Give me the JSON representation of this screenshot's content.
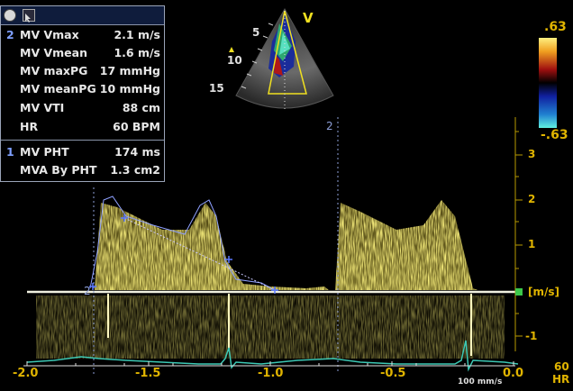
{
  "measurements_panel": {
    "groups": [
      {
        "index": "2",
        "rows": [
          {
            "label": "MV Vmax",
            "value": "2.1 m/s"
          },
          {
            "label": "MV Vmean",
            "value": "1.6 m/s"
          },
          {
            "label": "MV maxPG",
            "value": "17 mmHg"
          },
          {
            "label": "MV meanPG",
            "value": "10 mmHg"
          },
          {
            "label": "MV VTI",
            "value": "88 cm"
          },
          {
            "label": "HR",
            "value": "60 BPM"
          }
        ]
      },
      {
        "index": "1",
        "rows": [
          {
            "label": "MV PHT",
            "value": "174 ms"
          },
          {
            "label": "MVA By PHT",
            "value": "1.3 cm2"
          }
        ]
      }
    ]
  },
  "sector": {
    "orientation_marker": "V",
    "depth_labels": [
      "5",
      "10",
      "15"
    ]
  },
  "color_scale": {
    "top": ".63",
    "bottom": "-.63"
  },
  "velocity_axis": {
    "unit": "[m/s]",
    "ticks": [
      "3",
      "2",
      "1",
      "-1"
    ]
  },
  "time_axis": {
    "ticks": [
      "-2.0",
      "-1.5",
      "-1.0",
      "-0.5",
      "0.0"
    ]
  },
  "cursor_labels": {
    "vmax_marker": "2",
    "baseline_marker": "2"
  },
  "sweep_speed": "100 mm/s",
  "hr_readout": {
    "value": "60",
    "label": "HR"
  },
  "colors": {
    "spectrum": "#e8d440",
    "ecg": "#3cc8b4",
    "caliper": "#5a78ff",
    "scale_text": "#e0b400",
    "baseline_marker": "#3cc84a"
  }
}
